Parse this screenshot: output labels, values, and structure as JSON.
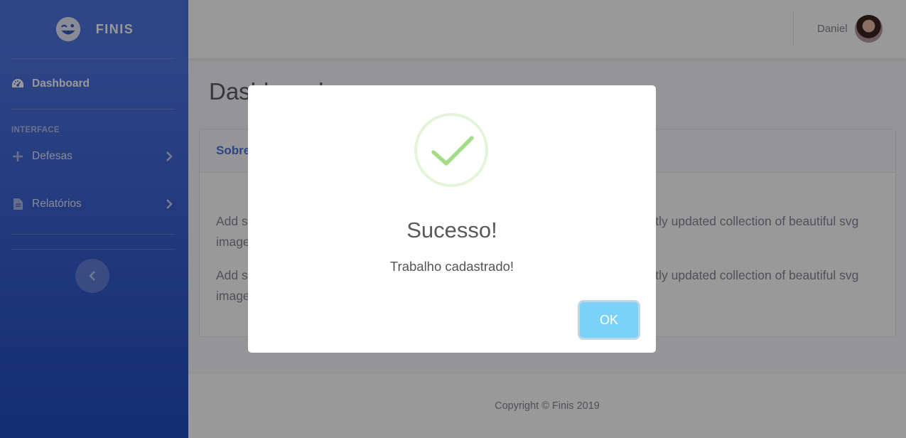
{
  "brand": {
    "name": "FINIS"
  },
  "sidebar": {
    "items": [
      {
        "label": "Dashboard",
        "icon": "tachometer-icon"
      },
      {
        "label": "Defesas",
        "icon": "plus-icon"
      },
      {
        "label": "Relatórios",
        "icon": "file-icon"
      }
    ],
    "heading": "INTERFACE"
  },
  "topbar": {
    "user_name": "Daniel"
  },
  "main": {
    "title": "Dashboard",
    "card": {
      "title": "Sobre",
      "paragraphs": [
        "Add some quality, svg illustrations to your project courtesy of unDraw, a constantly updated collection of beautiful svg images that you can use completely free and without attribution!",
        "Add some quality, svg illustrations to your project courtesy of unDraw, a constantly updated collection of beautiful svg images that you can use completely free and without attribution!"
      ]
    }
  },
  "footer": {
    "copyright": "Copyright © Finis 2019"
  },
  "modal": {
    "title": "Sucesso!",
    "text": "Trabalho cadastrado!",
    "ok_label": "OK",
    "icon": "success-check-icon"
  },
  "colors": {
    "primary": "#4e73df",
    "primary_dark": "#224abe",
    "ok_button": "#7cd1f9",
    "success": "#a5dc86"
  }
}
